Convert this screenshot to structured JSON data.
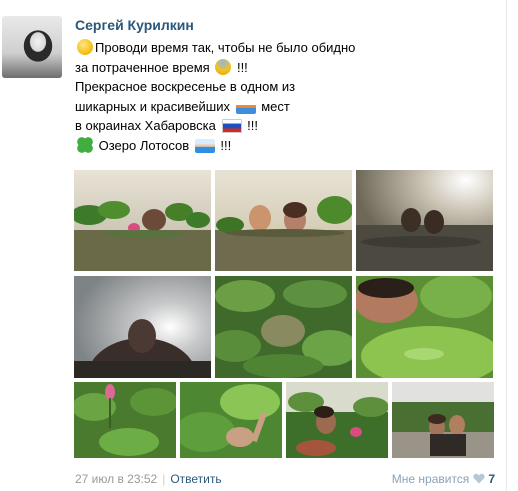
{
  "post": {
    "author": "Сергей Курилкин",
    "lines": [
      {
        "pre": "",
        "emoji1": "winking-face",
        "text": "Проводи время так, чтобы не было обидно",
        "emoji2": "",
        "post": ""
      },
      {
        "pre": "",
        "emoji1": "",
        "text": "за потраченное время",
        "emoji2": "screaming-face",
        "post": "!!!"
      },
      {
        "pre": "",
        "emoji1": "",
        "text": "Прекрасное воскресенье в одном из",
        "emoji2": "",
        "post": ""
      },
      {
        "pre": "",
        "emoji1": "",
        "text": "шикарных и красивейших",
        "emoji2": "rowboat",
        "post": "мест"
      },
      {
        "pre": "",
        "emoji1": "",
        "text": "в окраинах Хабаровска",
        "emoji2": "russian-flag",
        "post": "!!!"
      },
      {
        "pre": "",
        "emoji1": "four-leaf-clover",
        "text": "Озеро Лотосов",
        "emoji2": "swimmer",
        "post": "!!!"
      }
    ],
    "photos": [
      {
        "name": "lake-lotus-couple-photo",
        "scene": "Couple in lake among lotus leaves"
      },
      {
        "name": "lake-selfie-photo",
        "scene": "Couple selfie in water"
      },
      {
        "name": "lake-sunset-photo",
        "scene": "Heads above water at sunset"
      },
      {
        "name": "man-sky-photo",
        "scene": "Man against sunny sky"
      },
      {
        "name": "lotus-leaves-photo",
        "scene": "Lotus leaves on water"
      },
      {
        "name": "man-leaf-closeup-photo",
        "scene": "Man close-up with leaf"
      },
      {
        "name": "lotus-bud-photo",
        "scene": "Lotus bud among leaves"
      },
      {
        "name": "hand-leaf-photo",
        "scene": "Hand holding lotus leaf"
      },
      {
        "name": "couple-lotus-photo",
        "scene": "Couple among lotuses"
      },
      {
        "name": "couple-shore-photo",
        "scene": "Couple on shore"
      }
    ],
    "date": "27 июл в 23:52",
    "separator": "|",
    "reply_label": "Ответить",
    "like_label": "Мне нравится",
    "like_count": "7"
  },
  "colors": {
    "link": "#2b587a",
    "muted": "#999999"
  }
}
